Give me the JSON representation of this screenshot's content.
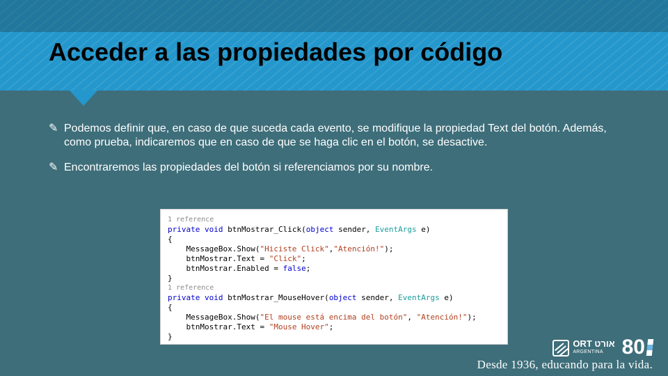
{
  "slide": {
    "title": "Acceder a las propiedades por código",
    "bullets": [
      "Podemos definir que, en caso de que suceda cada evento, se modifique la propiedad Text del botón. Además, como prueba, indicaremos que en caso de que se haga clic en el botón, se desactive.",
      "Encontraremos las propiedades del botón si referenciamos por su nombre."
    ]
  },
  "code": {
    "ref1": "1 reference",
    "sig1_kw": "private void",
    "sig1_name": " btnMostrar_Click(",
    "sig1_p1t": "object",
    "sig1_p1n": " sender, ",
    "sig1_p2t": "EventArgs",
    "sig1_p2n": " e)",
    "open": "{",
    "l1_a": "    MessageBox.Show(",
    "l1_s1": "\"Hiciste Click\"",
    "l1_m": ",",
    "l1_s2": "\"Atención!\"",
    "l1_e": ");",
    "l2_a": "    btnMostrar.Text = ",
    "l2_s": "\"Click\"",
    "l2_e": ";",
    "l3_a": "    btnMostrar.Enabled = ",
    "l3_k": "false",
    "l3_e": ";",
    "close": "}",
    "ref2": "1 reference",
    "sig2_kw": "private void",
    "sig2_name": " btnMostrar_MouseHover(",
    "sig2_p1t": "object",
    "sig2_p1n": " sender, ",
    "sig2_p2t": "EventArgs",
    "sig2_p2n": " e)",
    "l4_a": "    MessageBox.Show(",
    "l4_s1": "\"El mouse está encima del botón\"",
    "l4_m": ", ",
    "l4_s2": "\"Atención!\"",
    "l4_e": ");",
    "l5_a": "    btnMostrar.Text = ",
    "l5_s": "\"Mouse Hover\"",
    "l5_e": ";"
  },
  "branding": {
    "ort_name": "ORT",
    "ort_hebrew": "אורט",
    "ort_country": "ARGENTINA",
    "eighty": "80",
    "tagline": "Desde 1936, educando para la vida."
  }
}
